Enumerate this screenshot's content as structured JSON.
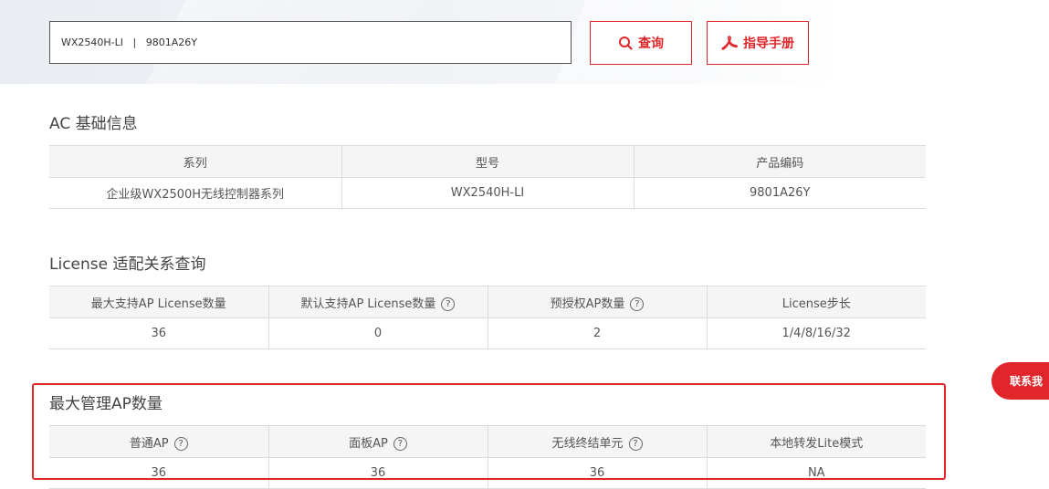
{
  "search": {
    "value": "WX2540H-LI   |   9801A26Y",
    "search_button_label": "查询",
    "guide_button_label": "指导手册"
  },
  "sections": {
    "ac_info": {
      "title": "AC 基础信息",
      "headers": [
        "系列",
        "型号",
        "产品编码"
      ],
      "row": [
        "企业级WX2500H无线控制器系列",
        "WX2540H-LI",
        "9801A26Y"
      ]
    },
    "license": {
      "title": "License 适配关系查询",
      "headers": [
        "最大支持AP License数量",
        "默认支持AP License数量",
        "预授权AP数量",
        "License步长"
      ],
      "row": [
        "36",
        "0",
        "2",
        "1/4/8/16/32"
      ]
    },
    "max_ap": {
      "title": "最大管理AP数量",
      "headers": [
        "普通AP",
        "面板AP",
        "无线终结单元",
        "本地转发Lite模式"
      ],
      "row": [
        "36",
        "36",
        "36",
        "NA"
      ]
    }
  },
  "help_glyph": "?",
  "contact_tab_label": "联系我",
  "colors": {
    "accent": "#e0262b",
    "header_bg": "#f5f5f5",
    "border": "#dcdcdc"
  }
}
